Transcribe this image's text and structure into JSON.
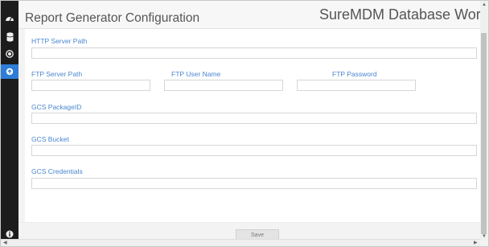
{
  "header": {
    "title": "Report Generator Configuration",
    "app_title": "SureMDM Database Worker"
  },
  "sidebar": {
    "items": [
      {
        "icon": "dashboard-icon"
      },
      {
        "icon": "database-icon"
      },
      {
        "icon": "record-icon"
      },
      {
        "icon": "settings-icon",
        "active": true
      }
    ],
    "bottom_icon": "info-icon",
    "active_color": "#2e7dd7"
  },
  "form": {
    "http_server_path": {
      "label": "HTTP Server Path",
      "value": ""
    },
    "ftp_server_path": {
      "label": "FTP Server Path",
      "value": ""
    },
    "ftp_user_name": {
      "label": "FTP User Name",
      "value": ""
    },
    "ftp_password": {
      "label": "FTP Password",
      "value": ""
    },
    "gcs_package_id": {
      "label": "GCS PackageID",
      "value": ""
    },
    "gcs_bucket": {
      "label": "GCS Bucket",
      "value": ""
    },
    "gcs_credentials": {
      "label": "GCS Credentials",
      "value": ""
    }
  },
  "footer": {
    "save_label": "Save"
  },
  "colors": {
    "label": "#4a86cf",
    "sidebar": "#1c1c1c"
  }
}
